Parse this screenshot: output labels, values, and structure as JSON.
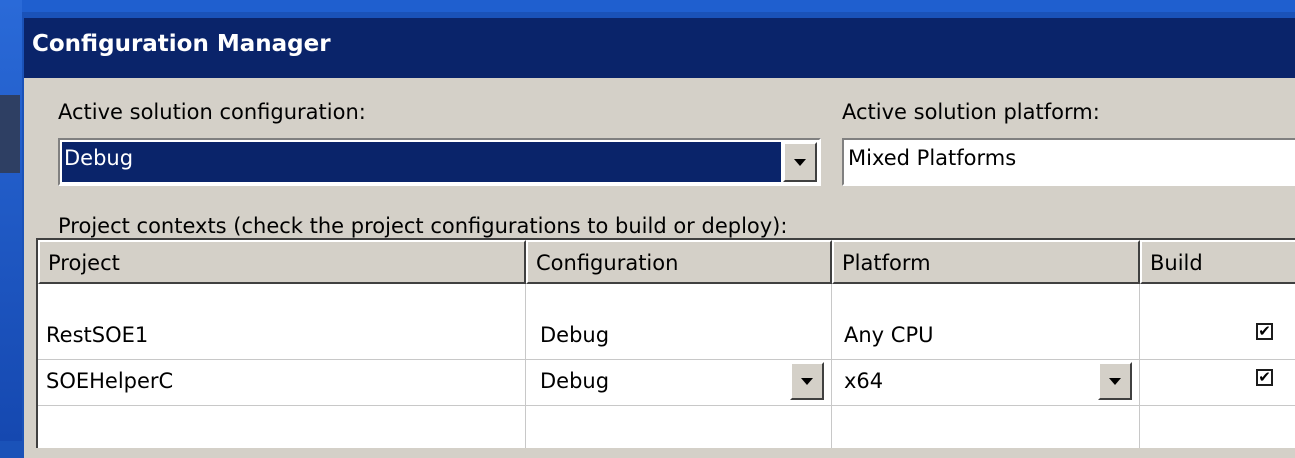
{
  "dialog": {
    "title": "Configuration Manager",
    "active_config_label": "Active solution configuration:",
    "active_config_value": "Debug",
    "active_platform_label": "Active solution platform:",
    "active_platform_value": "Mixed Platforms",
    "contexts_label": "Project contexts (check the project configurations to build or deploy):"
  },
  "grid": {
    "columns": [
      "Project",
      "Configuration",
      "Platform",
      "Build"
    ],
    "rows": [
      {
        "project": "RestSOE1",
        "configuration": "Debug",
        "platform": "Any CPU",
        "build": true,
        "build_mark": "✔"
      },
      {
        "project": "SOEHelperC",
        "configuration": "Debug",
        "platform": "x64",
        "build": true,
        "build_mark": "✔"
      }
    ]
  },
  "colors": {
    "titlebar": "#0a246a",
    "dialog_face": "#d4d0c8",
    "selection": "#0a246a",
    "desktop": "#1a52b8"
  },
  "icons": [
    "chevron-down-icon",
    "checkmark-icon"
  ]
}
